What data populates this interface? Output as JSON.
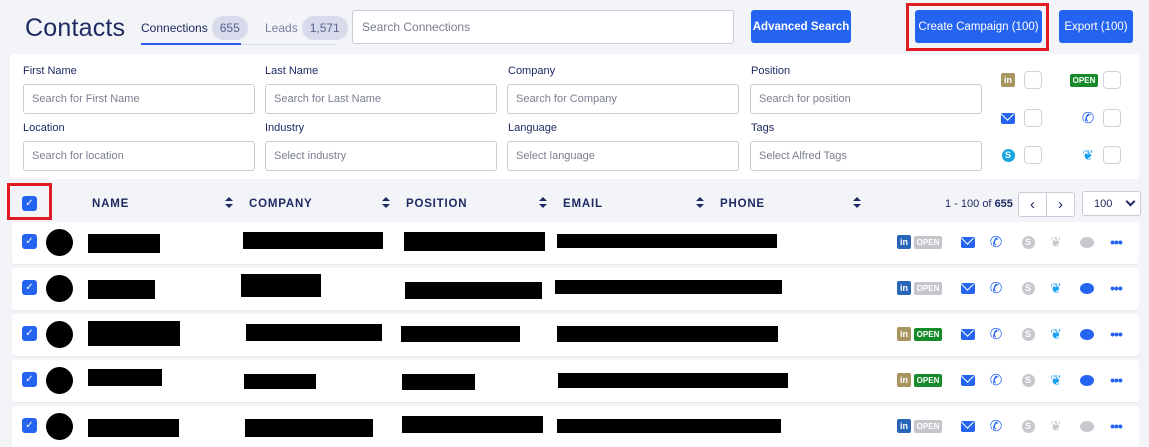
{
  "header": {
    "title": "Contacts",
    "tabs": [
      {
        "label": "Connections",
        "count": "655"
      },
      {
        "label": "Leads",
        "count": "1,571"
      }
    ],
    "search_placeholder": "Search Connections",
    "advanced_search_label": "Advanced Search",
    "create_campaign_label": "Create Campaign (100)",
    "export_label": "Export (100)"
  },
  "filters": {
    "first_name": {
      "label": "First Name",
      "placeholder": "Search for First Name"
    },
    "last_name": {
      "label": "Last Name",
      "placeholder": "Search for Last Name"
    },
    "company": {
      "label": "Company",
      "placeholder": "Search for Company"
    },
    "position": {
      "label": "Position",
      "placeholder": "Search for position"
    },
    "location": {
      "label": "Location",
      "placeholder": "Search for location"
    },
    "industry": {
      "label": "Industry",
      "placeholder": "Select industry"
    },
    "language": {
      "label": "Language",
      "placeholder": "Select language"
    },
    "tags": {
      "label": "Tags",
      "placeholder": "Select Alfred Tags"
    },
    "channel_toggles": [
      "linkedin-icon",
      "open-badge-icon",
      "mail-icon",
      "phone-icon",
      "skype-icon",
      "twitter-icon"
    ],
    "open_badge_text": "OPEN",
    "linkedin_text": "in",
    "skype_text": "S"
  },
  "table": {
    "columns": [
      "NAME",
      "COMPANY",
      "POSITION",
      "EMAIL",
      "PHONE"
    ],
    "pager": {
      "range": "1 - 100",
      "of_word": "of",
      "total": "655",
      "prev": "‹",
      "next": "›"
    },
    "per_page": "100",
    "rows": [
      {
        "checked": true,
        "linkedin": "blue",
        "open": false,
        "skype": false,
        "twitter": false,
        "chat": false
      },
      {
        "checked": true,
        "linkedin": "blue",
        "open": false,
        "skype": false,
        "twitter": true,
        "chat": true
      },
      {
        "checked": true,
        "linkedin": "olive",
        "open": true,
        "skype": false,
        "twitter": true,
        "chat": true
      },
      {
        "checked": true,
        "linkedin": "olive",
        "open": true,
        "skype": false,
        "twitter": true,
        "chat": true
      },
      {
        "checked": true,
        "linkedin": "blue",
        "open": false,
        "skype": false,
        "twitter": false,
        "chat": false
      }
    ]
  },
  "colors": {
    "accent": "#2564f0",
    "highlight": "#e01b22",
    "open_green": "#178a2c",
    "linkedin_olive": "#a89660"
  }
}
